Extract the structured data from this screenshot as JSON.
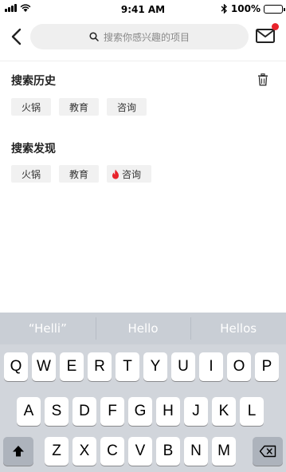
{
  "status_bar": {
    "time": "9:41 AM",
    "battery": "100%"
  },
  "header": {
    "search_placeholder": "搜索你感兴趣的项目",
    "back_icon": "chevron-left-icon",
    "mail_icon": "mail-icon",
    "mail_badge_color": "#e8232b"
  },
  "history": {
    "title": "搜索历史",
    "clear_icon": "trash-icon",
    "tags": [
      "火锅",
      "教育",
      "咨询"
    ]
  },
  "discover": {
    "title": "搜索发现",
    "tags": [
      "火锅",
      "教育",
      "咨询"
    ],
    "hot_icon": "fire-icon",
    "hot_color": "#e8232b"
  },
  "keyboard": {
    "suggestions": [
      "“Helli”",
      "Hello",
      "Hellos"
    ],
    "row1": [
      "Q",
      "W",
      "E",
      "R",
      "T",
      "Y",
      "U",
      "I",
      "O",
      "P"
    ],
    "row2": [
      "A",
      "S",
      "D",
      "F",
      "G",
      "H",
      "J",
      "K",
      "L"
    ],
    "row3": [
      "Z",
      "X",
      "C",
      "V",
      "B",
      "N",
      "M"
    ],
    "shift_icon": "shift-icon",
    "backspace_icon": "backspace-icon"
  }
}
